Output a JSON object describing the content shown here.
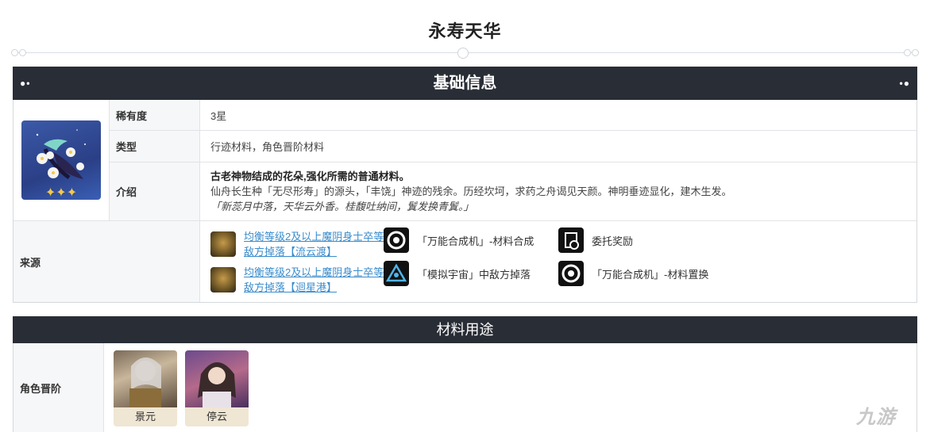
{
  "page": {
    "title": "永寿天华"
  },
  "basic_info": {
    "header": "基础信息",
    "rarity_label": "稀有度",
    "rarity_value": "3星",
    "type_label": "类型",
    "type_value": "行迹材料，角色晋阶材料",
    "intro_label": "介绍",
    "intro_bold": "古老神物结成的花朵,强化所需的普通材料。",
    "intro_text": "仙舟长生种「无尽形寿」的源头，「丰饶」神迹的残余。历经坎坷，求药之舟谒见天颜。神明垂迹显化，建木生发。",
    "intro_quote": "「新蕊月中落，天华云外香。桂馥吐纳间，鬒发换青鬒。」",
    "source_label": "来源",
    "sources": [
      {
        "text": "均衡等级2及以上魔阴身士卒等敌方掉落【流云渡】",
        "icon": "enemy-icon",
        "link": true
      },
      {
        "text": "「万能合成机」-材料合成",
        "icon": "synthesizer-icon",
        "link": false
      },
      {
        "text": "委托奖励",
        "icon": "assignment-icon",
        "link": false
      },
      {
        "text": "均衡等级2及以上魔阴身士卒等敌方掉落【迴星港】",
        "icon": "enemy-icon",
        "link": true
      },
      {
        "text": "「模拟宇宙」中敌方掉落",
        "icon": "simulated-universe-icon",
        "link": false
      },
      {
        "text": "「万能合成机」-材料置换",
        "icon": "synthesizer-icon",
        "link": false
      }
    ]
  },
  "usage": {
    "header": "材料用途",
    "label": "角色晋阶",
    "characters": [
      {
        "name": "景元"
      },
      {
        "name": "停云"
      }
    ]
  },
  "watermark": "九游"
}
